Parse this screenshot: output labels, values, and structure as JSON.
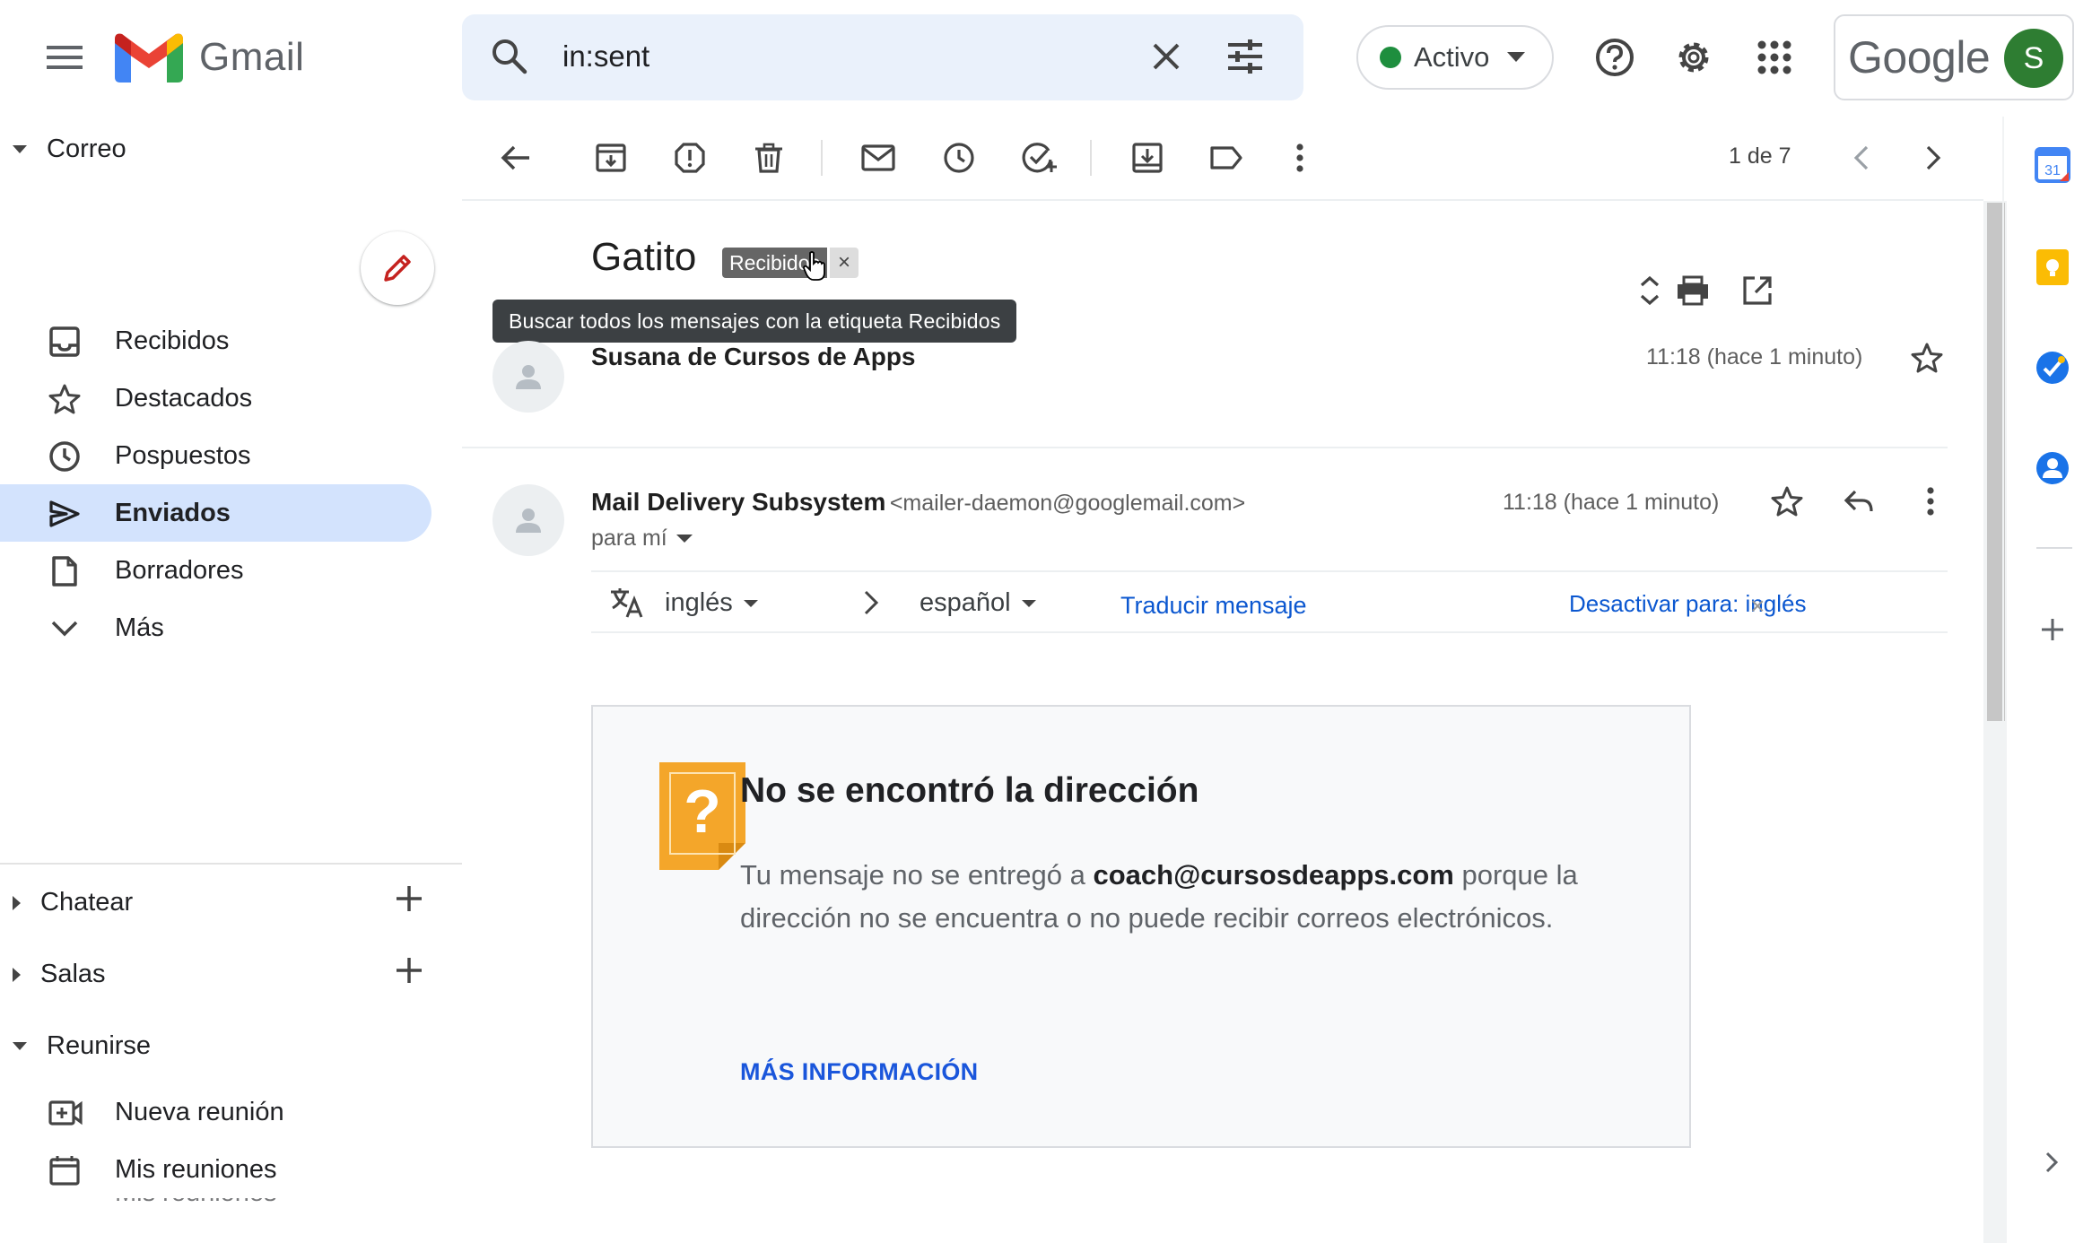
{
  "header": {
    "app_name": "Gmail",
    "search_value": "in:sent",
    "status_label": "Activo",
    "account_brand": "Google",
    "avatar_initial": "S"
  },
  "sidebar": {
    "mail_section": "Correo",
    "items": [
      {
        "label": "Recibidos",
        "icon": "inbox-icon",
        "active": false
      },
      {
        "label": "Destacados",
        "icon": "star-icon",
        "active": false
      },
      {
        "label": "Pospuestos",
        "icon": "clock-icon",
        "active": false
      },
      {
        "label": "Enviados",
        "icon": "send-icon",
        "active": true
      },
      {
        "label": "Borradores",
        "icon": "draft-icon",
        "active": false
      },
      {
        "label": "Más",
        "icon": "chevron-down-icon",
        "active": false
      }
    ],
    "chat_section": "Chatear",
    "rooms_section": "Salas",
    "meet_section": "Reunirse",
    "meet_items": [
      {
        "label": "Nueva reunión",
        "icon": "video-add-icon"
      },
      {
        "label": "Mis reuniones",
        "icon": "calendar-icon"
      }
    ]
  },
  "toolbar": {
    "page_count": "1 de 7"
  },
  "thread": {
    "subject": "Gatito",
    "label_chip": "Recibidos",
    "label_remove": "×",
    "tooltip": "Buscar todos los mensajes con la etiqueta Recibidos",
    "messages": [
      {
        "sender": "Susana de Cursos de Apps",
        "time": "11:18 (hace 1 minuto)"
      },
      {
        "sender": "Mail Delivery Subsystem",
        "email": "<mailer-daemon@googlemail.com>",
        "recipient": "para mí",
        "time": "11:18 (hace 1 minuto)"
      }
    ],
    "translate": {
      "from": "inglés",
      "to": "español",
      "action": "Traducir mensaje",
      "disable": "Desactivar para: inglés",
      "disable_close": "×"
    },
    "bounce": {
      "title": "No se encontró la dirección",
      "body_prefix": "Tu mensaje no se entregó a ",
      "address": "coach@cursosdeapps.com",
      "body_suffix": " porque la dirección no se encuentra o no puede recibir correos electrónicos.",
      "link": "MÁS INFORMACIÓN"
    }
  },
  "colors": {
    "accent_blue": "#0b57d0",
    "active_nav": "#d3e3fd",
    "status_green": "#1e8e3e",
    "avatar_green": "#2e7d32",
    "bounce_icon": "#f4a62a"
  }
}
